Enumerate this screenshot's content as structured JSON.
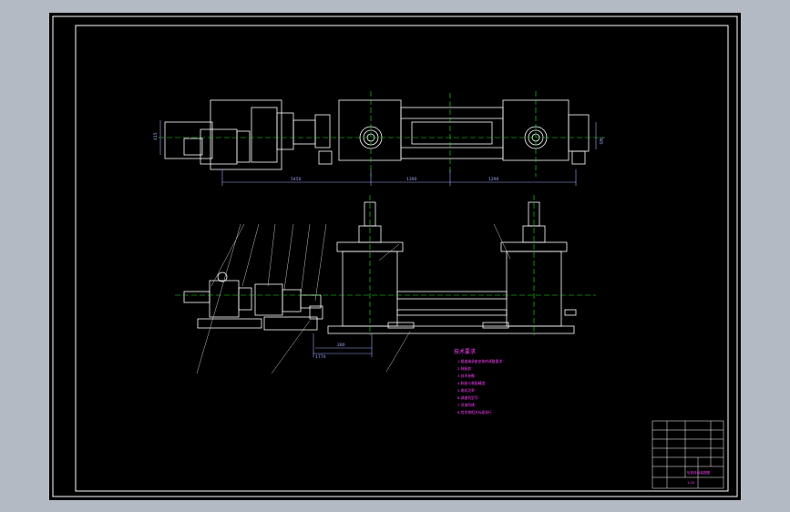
{
  "colors": {
    "viewport_bg": "#b4bac4",
    "sheet_bg": "#000000",
    "line": "#ffffff",
    "center": "#19e619",
    "dim": "#a0a8ff",
    "text_magenta": "#ff40ff",
    "leader": "#c0c0c0"
  },
  "dimensions": {
    "top": [
      "5450",
      "1390",
      "1290"
    ],
    "left_vertical": "415",
    "right_vertical": "385",
    "bottom": [
      "1770",
      "280"
    ]
  },
  "technical_notes": {
    "title": "技术要求",
    "lines": [
      "1.辊道轴承座安装的调整要求：",
      "2.装配前：",
      "3.技术参数：",
      "4.制造与装配精度：",
      "5.电机功率：",
      "6.减速机型号：",
      "7.涂漆防锈：",
      "8.其余按相关标准执行"
    ]
  },
  "title_block": {
    "drawing_name": "轧机传动装配图",
    "scale": "1:20"
  }
}
